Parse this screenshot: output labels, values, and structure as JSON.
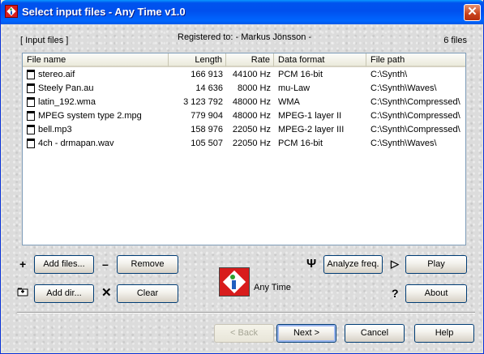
{
  "window": {
    "title": "Select input files - Any Time v1.0",
    "close_label": "✕"
  },
  "header": {
    "section_label": "[ Input files ]",
    "registered": "Registered to: - Markus Jönsson -",
    "file_count": "6 files"
  },
  "columns": [
    "File name",
    "Length",
    "Rate",
    "Data format",
    "File path"
  ],
  "files": [
    {
      "name": "stereo.aif",
      "length": "166 913",
      "rate": "44100 Hz",
      "format": "PCM 16-bit",
      "path": "C:\\Synth\\",
      "icon": "audio-file-icon"
    },
    {
      "name": "Steely Pan.au",
      "length": "14 636",
      "rate": "8000 Hz",
      "format": "mu-Law",
      "path": "C:\\Synth\\Waves\\",
      "icon": "audio-file-icon"
    },
    {
      "name": "latin_192.wma",
      "length": "3 123 792",
      "rate": "48000 Hz",
      "format": "WMA",
      "path": "C:\\Synth\\Compressed\\",
      "icon": "audio-file-icon"
    },
    {
      "name": "MPEG system type 2.mpg",
      "length": "779 904",
      "rate": "48000 Hz",
      "format": "MPEG-1 layer II",
      "path": "C:\\Synth\\Compressed\\",
      "icon": "audio-file-icon"
    },
    {
      "name": "bell.mp3",
      "length": "158 976",
      "rate": "22050 Hz",
      "format": "MPEG-2 layer III",
      "path": "C:\\Synth\\Compressed\\",
      "icon": "audio-file-icon"
    },
    {
      "name": "4ch - drmapan.wav",
      "length": "105 507",
      "rate": "22050 Hz",
      "format": "PCM 16-bit",
      "path": "C:\\Synth\\Waves\\",
      "icon": "audio-file-icon"
    }
  ],
  "buttons": {
    "add_files": "Add files...",
    "remove": "Remove",
    "add_dir": "Add dir...",
    "clear": "Clear",
    "analyze": "Analyze freq.",
    "play": "Play",
    "about": "About",
    "back": "< Back",
    "next": "Next >",
    "cancel": "Cancel",
    "help": "Help"
  },
  "glyphs": {
    "plus": "+",
    "minus": "–",
    "cross": "✕",
    "tuning_fork": "Ψ",
    "play": "▷",
    "question": "?"
  },
  "logo_label": "Any Time",
  "colors": {
    "titlebar": "#0054e3",
    "logo_red": "#d81c1c",
    "logo_green": "#2ca02c",
    "logo_blue": "#1f5fbf"
  }
}
